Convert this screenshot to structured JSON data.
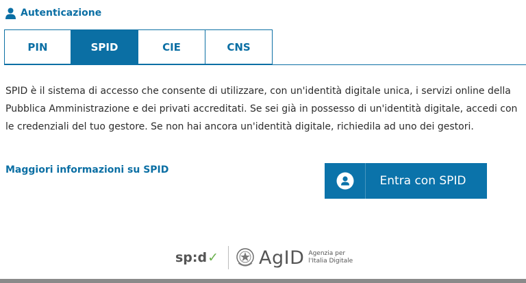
{
  "section": {
    "title": "Autenticazione",
    "icon": "user-icon"
  },
  "tabs": [
    {
      "label": "PIN",
      "active": false
    },
    {
      "label": "SPID",
      "active": true
    },
    {
      "label": "CIE",
      "active": false
    },
    {
      "label": "CNS",
      "active": false
    }
  ],
  "description": "SPID è il sistema di accesso che consente di utilizzare, con un'identità digitale unica, i servizi online della\nPubblica Amministrazione e dei privati accreditati. Se sei già in possesso di un'identità digitale, accedi con\nle credenziali del tuo gestore. Se non hai ancora un'identità digitale, richiedila ad uno dei gestori.",
  "more_info_link": "Maggiori informazioni su SPID",
  "login_button": {
    "label": "Entra con SPID",
    "icon": "user-circle-icon"
  },
  "footer": {
    "spid_logo_text": "sp:d",
    "spid_logo_check": "✓",
    "agid_text": "AgID",
    "agid_sub_line1": "Agenzia per",
    "agid_sub_line2": "l'Italia Digitale"
  },
  "colors": {
    "primary": "#0b6fa4",
    "button": "#0b73aa",
    "text": "#2b2b2b",
    "check_green": "#6ab04c"
  }
}
